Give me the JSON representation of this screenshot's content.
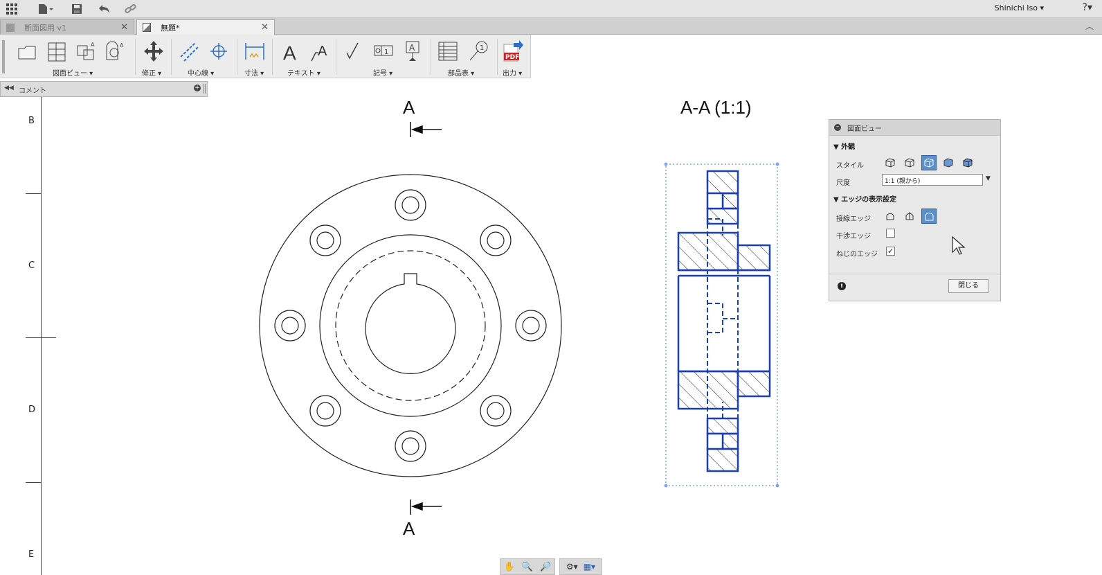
{
  "topbar": {
    "user_name": "Shinichi Iso ▾",
    "help": "?▾"
  },
  "tabs": [
    {
      "label": "断面図用 v1",
      "close": "✕",
      "active": false
    },
    {
      "label": "無題*",
      "close": "✕",
      "active": true
    }
  ],
  "toolbar": {
    "groups": [
      {
        "label": "図面ビュー ▾"
      },
      {
        "label": "修正 ▾"
      },
      {
        "label": "中心線 ▾"
      },
      {
        "label": "寸法 ▾"
      },
      {
        "label": "テキスト ▾"
      },
      {
        "label": "記号 ▾"
      },
      {
        "label": "部品表 ▾"
      },
      {
        "label": "出力 ▾"
      }
    ],
    "symbol_number": "1",
    "pdf_label": "PDF"
  },
  "comment_bar": {
    "label": "コメント"
  },
  "ruler": {
    "labels": [
      "B",
      "C",
      "D",
      "E"
    ]
  },
  "drawing": {
    "section_label_top": "A",
    "section_label_bottom": "A",
    "section_view_title": "A-A (1:1)"
  },
  "panel": {
    "title": "図面ビュー",
    "section_appearance": "外観",
    "style_label": "スタイル",
    "scale_label": "尺度",
    "scale_value": "1:1 (親から)",
    "section_edges": "エッジの表示設定",
    "tangent_edges_label": "接線エッジ",
    "interference_edges_label": "干渉エッジ",
    "interference_checked": false,
    "thread_edges_label": "ねじのエッジ",
    "thread_checked": true,
    "close_button": "閉じる"
  },
  "colors": {
    "selection_blue": "#1a3fb0",
    "button_selected": "#5a8fc9"
  }
}
